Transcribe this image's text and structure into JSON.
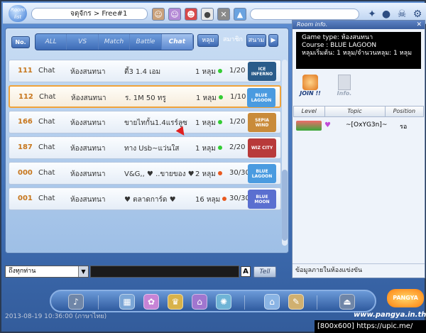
{
  "topbar": {
    "logo_text": "Room list",
    "breadcrumb": "จตุจักร > Free#1"
  },
  "filters": {
    "no_label": "No.",
    "tabs": [
      "ALL",
      "VS",
      "Match",
      "Battle",
      "Chat"
    ],
    "active_tab": "Chat",
    "sort_hole": "หลุม",
    "sort_member": "สมาชิก",
    "sort_item": "สนาม"
  },
  "rooms": [
    {
      "num": "111",
      "type": "Chat",
      "mode": "ห้องสนทนา",
      "name": "ตี้3 1.4 เอม",
      "holes": "1 หลุม",
      "count": "1/20",
      "course": "ICE INFERNO",
      "status_color": "#33cc33"
    },
    {
      "num": "112",
      "type": "Chat",
      "mode": "ห้องสนทนา",
      "name": "ร. 1M 50 ทรู",
      "holes": "1 หลุม",
      "count": "1/10",
      "course": "BLUE LAGOON",
      "status_color": "#33cc33"
    },
    {
      "num": "166",
      "type": "Chat",
      "mode": "ห้องสนทนา",
      "name": "ขายไทกั้น1.4แรร์ลูซ",
      "holes": "1 หลุม",
      "count": "1/20",
      "course": "SEPIA WIND",
      "status_color": "#33cc33"
    },
    {
      "num": "187",
      "type": "Chat",
      "mode": "ห้องสนทนา",
      "name": "ทาง Usb~แว่นใส",
      "holes": "1 หลุม",
      "count": "2/20",
      "course": "WIZ CITY",
      "status_color": "#33cc33"
    },
    {
      "num": "000",
      "type": "Chat",
      "mode": "ห้องสนทนา",
      "name": "V&G,, ♥ ..ขายของ ♥",
      "holes": "2 หลุม",
      "count": "30/30",
      "course": "BLUE LAGOON",
      "status_color": "#e85a20"
    },
    {
      "num": "001",
      "type": "Chat",
      "mode": "ห้องสนทนา",
      "name": "♥ ตลาดการ์ด ♥",
      "holes": "16 หลุม",
      "count": "30/30",
      "course": "BLUE MOON",
      "status_color": "#e85a20"
    }
  ],
  "chat": {
    "whisper_target": "ถึงทุกท่าน",
    "font_button": "A",
    "tell_button": "Tell"
  },
  "room_info": {
    "title": "Room info.",
    "game_type": "Game type: ห้องสนทนา",
    "course": "Course : BLUE LAGOON",
    "hole_start": "หลุมเริ่มต้น: 1 หลุม/จำนวนหลุม: 1 หลุม",
    "join_label": "JOIN !!",
    "info_label": "Info.",
    "columns": [
      "Level",
      "Topic",
      "Position"
    ],
    "player_name": "~[OxYG3n]~",
    "player_position": "รอ",
    "footer": "ข้อมูลภายในห้องแข่งขัน"
  },
  "footer": {
    "timestamp": "2013-08-19 10:36:00 (ภาษาไทย)",
    "site": "www.pangya.in.th",
    "logo": "PANGYA"
  },
  "watermark": "[800x600] https://upic.me/"
}
